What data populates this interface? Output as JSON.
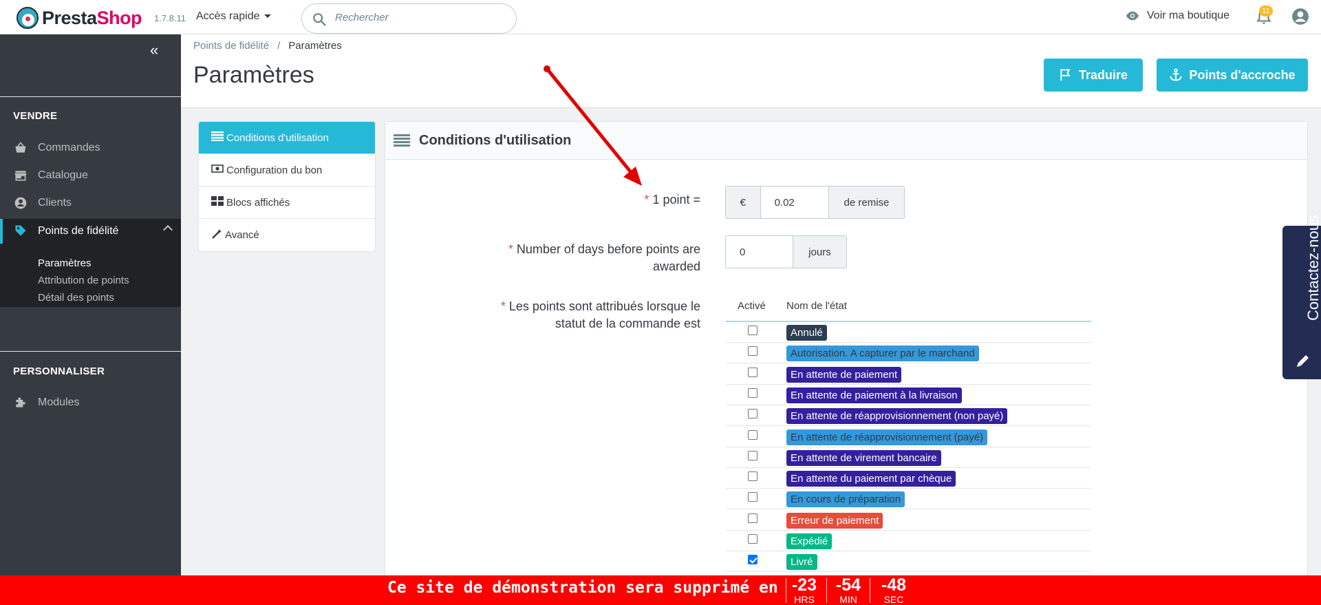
{
  "header": {
    "logo_text_a": "Presta",
    "logo_text_b": "Shop",
    "version": "1.7.8.11",
    "quick_access": "Accès rapide",
    "search_placeholder": "Rechercher",
    "view_shop": "Voir ma boutique",
    "notifications_count": "11"
  },
  "sidebar": {
    "section_sell": "VENDRE",
    "items": [
      {
        "label": "Commandes",
        "icon": "basket-icon"
      },
      {
        "label": "Catalogue",
        "icon": "store-icon"
      },
      {
        "label": "Clients",
        "icon": "account-circle-icon"
      },
      {
        "label": "Points de fidélité",
        "icon": "tag-icon"
      }
    ],
    "subitems": [
      "Paramètres",
      "Attribution de points",
      "Détail des points"
    ],
    "section_customize": "PERSONNALISER",
    "modules": "Modules"
  },
  "breadcrumb": {
    "parent": "Points de fidélité",
    "separator": "/",
    "current": "Paramètres"
  },
  "page_title": "Paramètres",
  "toolbar": {
    "translate": "Traduire",
    "hooks": "Points d'accroche"
  },
  "tabs": [
    {
      "label": "Conditions d'utilisation",
      "icon": "list-icon",
      "active": true
    },
    {
      "label": "Configuration du bon",
      "icon": "money-icon",
      "active": false
    },
    {
      "label": "Blocs affichés",
      "icon": "grid-icon",
      "active": false
    },
    {
      "label": "Avancé",
      "icon": "wand-icon",
      "active": false
    }
  ],
  "panel": {
    "title": "Conditions d'utilisation",
    "point_label": "1 point =",
    "point_prefix": "€",
    "point_value": "0.02",
    "point_suffix": "de remise",
    "days_label": "Number of days before points are awarded",
    "days_value": "0",
    "days_suffix": "jours",
    "status_label": "Les points sont attribués lorsque le statut de la commande est",
    "col_active": "Activé",
    "col_name": "Nom de l'état",
    "statuses": [
      {
        "name": "Annulé",
        "color": "#2c3e50",
        "text": "#ffffff",
        "checked": false
      },
      {
        "name": "Autorisation. A capturer par le marchand",
        "color": "#3498db",
        "text": "#363a41",
        "checked": false
      },
      {
        "name": "En attente de paiement",
        "color": "#34209e",
        "text": "#ffffff",
        "checked": false
      },
      {
        "name": "En attente de paiement à la livraison",
        "color": "#34209e",
        "text": "#ffffff",
        "checked": false
      },
      {
        "name": "En attente de réapprovisionnement (non payé)",
        "color": "#34209e",
        "text": "#ffffff",
        "checked": false
      },
      {
        "name": "En attente de réapprovisionnement (payé)",
        "color": "#3498db",
        "text": "#363a41",
        "checked": false
      },
      {
        "name": "En attente de virement bancaire",
        "color": "#34209e",
        "text": "#ffffff",
        "checked": false
      },
      {
        "name": "En attente du paiement par chèque",
        "color": "#34209e",
        "text": "#ffffff",
        "checked": false
      },
      {
        "name": "En cours de préparation",
        "color": "#3498db",
        "text": "#363a41",
        "checked": false
      },
      {
        "name": "Erreur de paiement",
        "color": "#e74c3c",
        "text": "#ffffff",
        "checked": false
      },
      {
        "name": "Expédié",
        "color": "#01b887",
        "text": "#ffffff",
        "checked": false
      },
      {
        "name": "Livré",
        "color": "#01b887",
        "text": "#ffffff",
        "checked": true
      }
    ]
  },
  "contact_tab": "Contactez-nous",
  "banner": {
    "message": "Ce site de démonstration sera supprimé en",
    "hours": "-23",
    "hours_unit": "HRS",
    "minutes": "-54",
    "minutes_unit": "MIN",
    "seconds": "-48",
    "seconds_unit": "SEC"
  },
  "colors": {
    "primary": "#25b9d7",
    "sidebar": "#363a41",
    "banner": "#fd0000",
    "annotation_arrow": "#e00000"
  }
}
